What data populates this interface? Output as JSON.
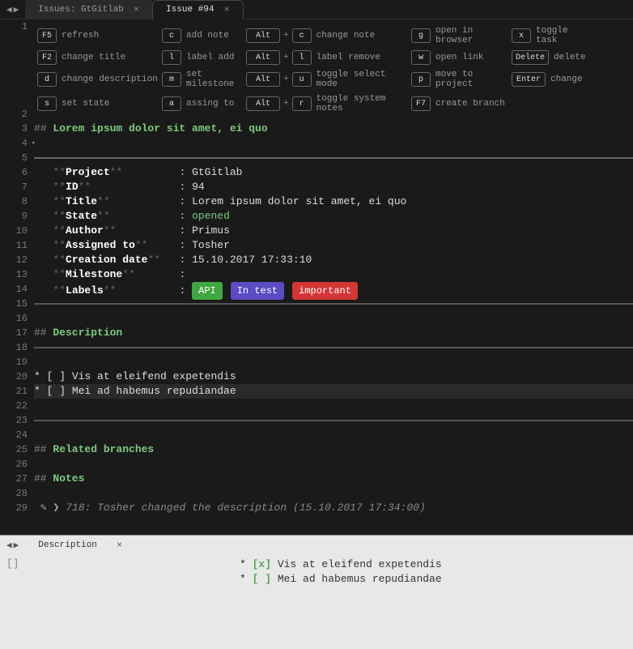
{
  "tabs": [
    {
      "label": "Issues: GtGitlab",
      "active": false
    },
    {
      "label": "Issue #94",
      "active": true
    }
  ],
  "shortcuts": {
    "rows": [
      [
        {
          "keys": [
            "F5"
          ],
          "label": "refresh"
        },
        {
          "keys": [
            "c"
          ],
          "label": "add note"
        },
        {
          "keys": [
            "Alt",
            "c"
          ],
          "label": "change note"
        },
        {
          "keys": [
            "g"
          ],
          "label": "open in browser"
        },
        {
          "keys": [
            "x"
          ],
          "label": "toggle task"
        }
      ],
      [
        {
          "keys": [
            "F2"
          ],
          "label": "change title"
        },
        {
          "keys": [
            "l"
          ],
          "label": "label add"
        },
        {
          "keys": [
            "Alt",
            "l"
          ],
          "label": "label remove"
        },
        {
          "keys": [
            "w"
          ],
          "label": "open link"
        },
        {
          "keys": [
            "Delete"
          ],
          "label": "delete"
        }
      ],
      [
        {
          "keys": [
            "d"
          ],
          "label": "change description"
        },
        {
          "keys": [
            "m"
          ],
          "label": "set milestone"
        },
        {
          "keys": [
            "Alt",
            "u"
          ],
          "label": "toggle select mode"
        },
        {
          "keys": [
            "p"
          ],
          "label": "move to project"
        },
        {
          "keys": [
            "Enter"
          ],
          "label": "change"
        }
      ],
      [
        {
          "keys": [
            "s"
          ],
          "label": "set state"
        },
        {
          "keys": [
            "a"
          ],
          "label": "assing to"
        },
        {
          "keys": [
            "Alt",
            "r"
          ],
          "label": "toggle system notes"
        },
        {
          "keys": [
            "F7"
          ],
          "label": "create branch"
        },
        null
      ]
    ]
  },
  "title_heading": "Lorem ipsum dolor sit amet, ei quo",
  "fields": {
    "project": {
      "label": "Project",
      "value": "GtGitlab"
    },
    "id": {
      "label": "ID",
      "value": "94"
    },
    "title": {
      "label": "Title",
      "value": "Lorem ipsum dolor sit amet, ei quo"
    },
    "state": {
      "label": "State",
      "value": "opened"
    },
    "author": {
      "label": "Author",
      "value": "Primus"
    },
    "assigned": {
      "label": "Assigned to",
      "value": "Tosher"
    },
    "created": {
      "label": "Creation date",
      "value": "15.10.2017 17:33:10"
    },
    "milestone": {
      "label": "Milestone",
      "value": ""
    },
    "labels_label": "Labels",
    "labels": [
      {
        "text": "API",
        "color": "green"
      },
      {
        "text": "In test",
        "color": "purple"
      },
      {
        "text": "important",
        "color": "red"
      }
    ]
  },
  "sections": {
    "description": "Description",
    "related": "Related branches",
    "notes": "Notes"
  },
  "tasks": [
    {
      "checked": false,
      "text": "Vis at eleifend expetendis"
    },
    {
      "checked": false,
      "text": "Mei ad habemus repudiandae"
    }
  ],
  "note": {
    "text": "718: Tosher changed the description (15.10.2017 17:34:00)"
  },
  "lower": {
    "tab": "Description",
    "gutter": "[]",
    "tasks": [
      {
        "marker": "[x]",
        "text": "Vis at eleifend expetendis"
      },
      {
        "marker": "[ ]",
        "text": "Mei ad habemus repudiandae"
      }
    ]
  },
  "line_numbers": [
    "1",
    "2",
    "3",
    "4",
    "5",
    "6",
    "7",
    "8",
    "9",
    "10",
    "11",
    "12",
    "13",
    "14",
    "15",
    "16",
    "17",
    "18",
    "19",
    "20",
    "21",
    "22",
    "23",
    "24",
    "25",
    "26",
    "27",
    "28",
    "29"
  ]
}
